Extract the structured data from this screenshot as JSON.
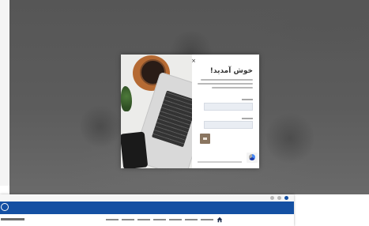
{
  "modal": {
    "welcome_title": "خوش آمدید!",
    "close_symbol": "×",
    "icons": {
      "close": "close-icon",
      "submit": "login-arrow-icon",
      "captcha": "recaptcha-icon"
    }
  },
  "site": {
    "icons": {
      "logo": "university-logo-icon",
      "home": "home-icon",
      "browser_actions": [
        "share-icon",
        "star-icon",
        "profile-icon"
      ]
    }
  },
  "colors": {
    "header_blue": "#1450a3",
    "submit_brown": "#8a7560",
    "overlay_gray": "#5a5a5a"
  }
}
